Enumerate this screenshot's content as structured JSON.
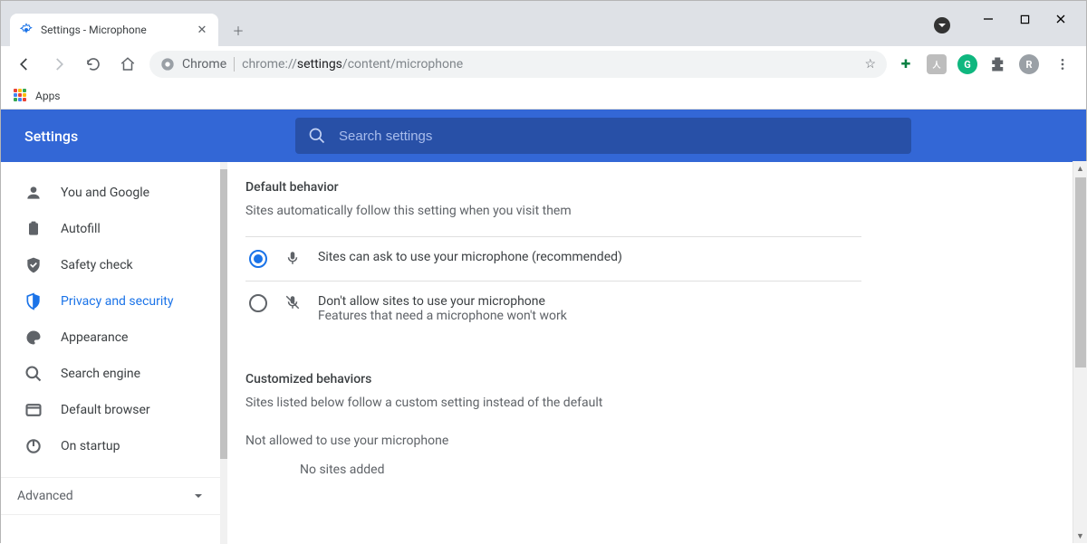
{
  "tab": {
    "title": "Settings - Microphone"
  },
  "window": {
    "minimize": "–",
    "maximize": "◻",
    "close": "✕"
  },
  "address": {
    "label": "Chrome",
    "prefix": "chrome://",
    "bold": "settings",
    "suffix": "/content/microphone"
  },
  "bookmarks_bar": {
    "apps": "Apps"
  },
  "avatar_letter": "R",
  "header": {
    "title": "Settings"
  },
  "search": {
    "placeholder": "Search settings"
  },
  "sidebar": {
    "items": [
      {
        "label": "You and Google"
      },
      {
        "label": "Autofill"
      },
      {
        "label": "Safety check"
      },
      {
        "label": "Privacy and security"
      },
      {
        "label": "Appearance"
      },
      {
        "label": "Search engine"
      },
      {
        "label": "Default browser"
      },
      {
        "label": "On startup"
      }
    ],
    "advanced": "Advanced"
  },
  "main": {
    "section1": {
      "title": "Default behavior",
      "subtitle": "Sites automatically follow this setting when you visit them",
      "option1": {
        "label": "Sites can ask to use your microphone (recommended)"
      },
      "option2": {
        "label": "Don't allow sites to use your microphone",
        "sub": "Features that need a microphone won't work"
      }
    },
    "section2": {
      "title": "Customized behaviors",
      "subtitle": "Sites listed below follow a custom setting instead of the default",
      "not_allowed_title": "Not allowed to use your microphone",
      "empty": "No sites added"
    }
  }
}
